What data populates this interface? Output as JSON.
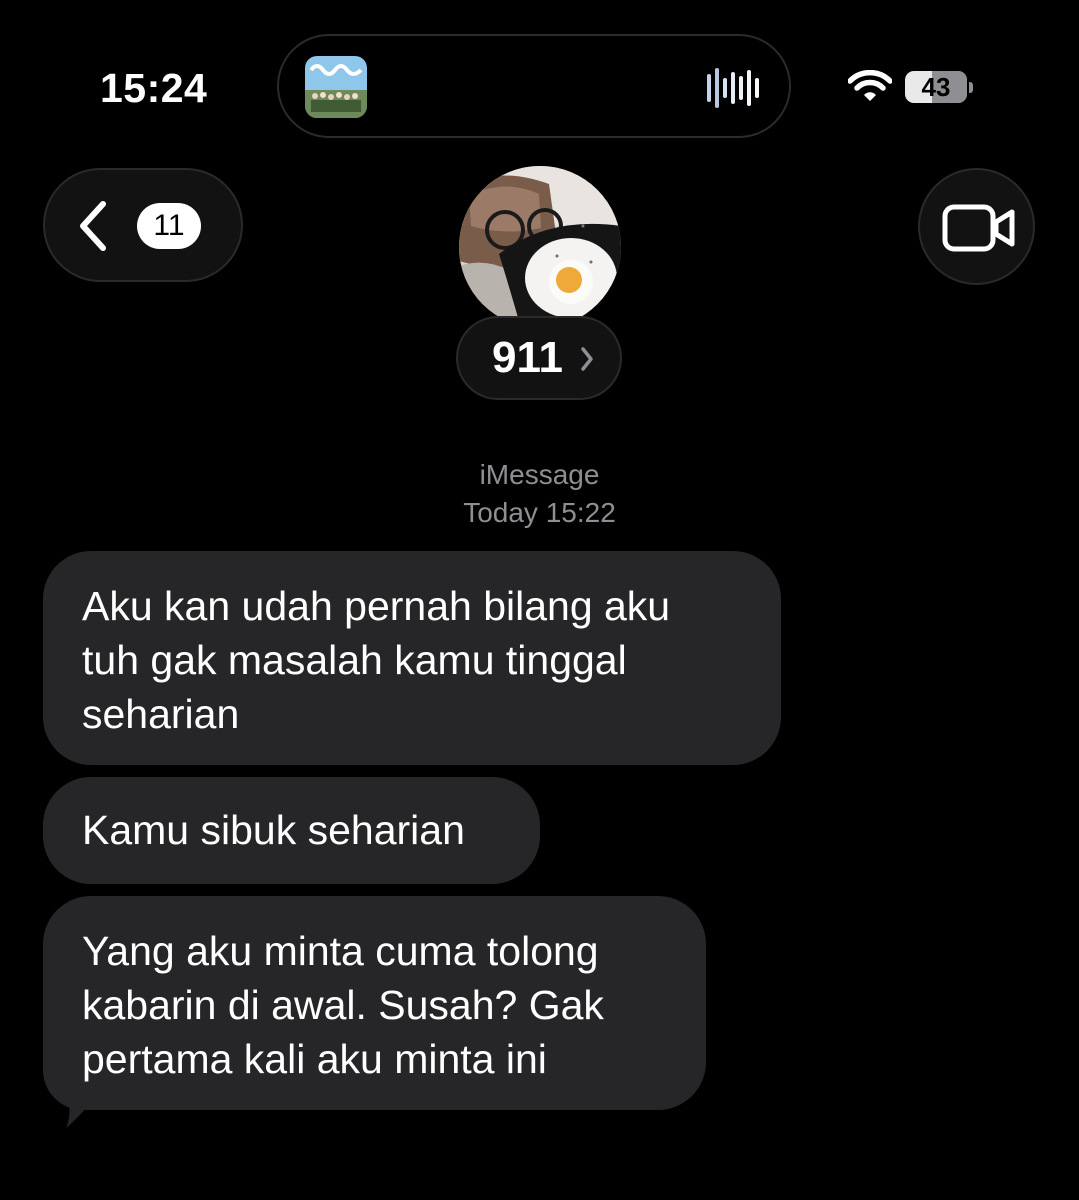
{
  "status_bar": {
    "time": "15:24",
    "battery_level": "43",
    "icons": [
      "wifi-icon",
      "battery-icon"
    ]
  },
  "dynamic_island": {
    "icons": [
      "album-art-icon",
      "audio-waveform-icon"
    ]
  },
  "header": {
    "back_icon": "chevron-left-icon",
    "unread_count": "11",
    "contact_name": "911",
    "contact_chevron_icon": "chevron-right-icon",
    "video_icon": "video-camera-icon"
  },
  "thread": {
    "service": "iMessage",
    "timestamp": "Today 15:22",
    "messages": [
      {
        "direction": "incoming",
        "text": "Aku kan udah pernah bilang aku\ntuh gak masalah kamu tinggal\nseharian"
      },
      {
        "direction": "incoming",
        "text": "Kamu sibuk seharian"
      },
      {
        "direction": "incoming",
        "text": "Yang aku minta cuma tolong\nkabarin di awal. Susah? Gak\npertama kali aku minta ini"
      }
    ]
  },
  "colors": {
    "background": "#000000",
    "incoming_bubble": "#262628",
    "secondary_text": "#8e8e93",
    "control_fill": "#121213"
  }
}
